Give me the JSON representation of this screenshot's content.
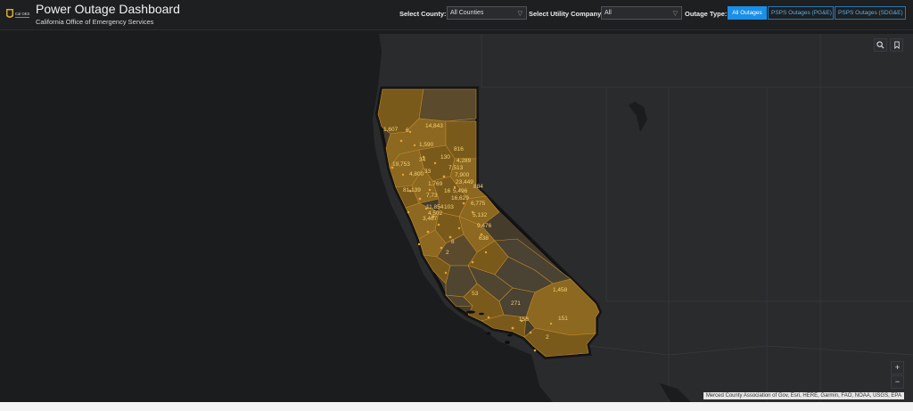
{
  "header": {
    "logo_text": "Cal OES",
    "title": "Power Outage Dashboard",
    "subtitle": "California Office of Emergency Services"
  },
  "filters": {
    "county_label": "Select County:",
    "county_value": "All Counties",
    "utility_label": "Select Utility Company",
    "utility_value": "All",
    "outage_type_label": "Outage Type:",
    "outage_types": [
      "All Outages",
      "PSPS Outages (PG&E)",
      "PSPS Outages (SDG&E)"
    ],
    "active_outage_type": "All Outages"
  },
  "map": {
    "attribution": "Merced County Association of Gov, Esri, HERE, Garmin, FAO, NOAA, USGS, EPA",
    "zoom_in": "+",
    "zoom_out": "−",
    "county_outage_counts": [
      "1,607",
      "6",
      "14,843",
      "1,590",
      "816",
      "34",
      "4,289",
      "130",
      "7,513",
      "7,900",
      "19,753",
      "4,800",
      "33",
      "1,769",
      "23,449",
      "884",
      "81,139",
      "16",
      "5,496",
      "16,629",
      "7,73",
      "6,775",
      "11,854",
      "103",
      "4,502",
      "5,132",
      "3,467",
      "9,476",
      "8",
      "638",
      "2",
      "1,458",
      "53",
      "271",
      "158",
      "151",
      "2"
    ],
    "colors": {
      "fill": "#7a5a1b",
      "fill_light": "#8c6820",
      "outline": "#c08a2c",
      "labels": "#f6d178",
      "background": "#1b1c1e"
    }
  }
}
